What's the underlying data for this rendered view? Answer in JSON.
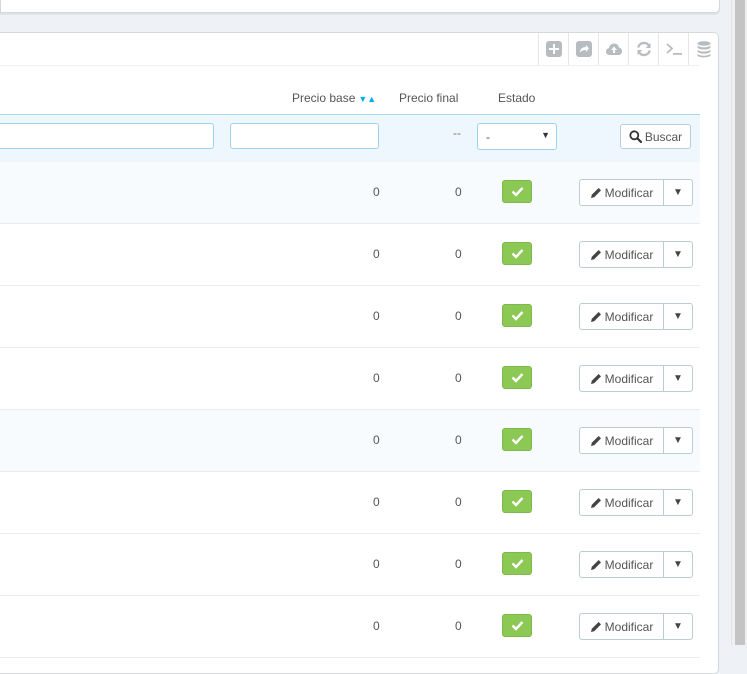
{
  "columns": {
    "precio_base": "Precio base",
    "precio_final": "Precio final",
    "estado": "Estado"
  },
  "filters": {
    "precio_final_placeholder": "--",
    "estado_value": "-",
    "search_label": "Buscar"
  },
  "rows": [
    {
      "precio_base": "0",
      "precio_final": "0",
      "edit_label": "Modificar"
    },
    {
      "precio_base": "0",
      "precio_final": "0",
      "edit_label": "Modificar"
    },
    {
      "precio_base": "0",
      "precio_final": "0",
      "edit_label": "Modificar"
    },
    {
      "precio_base": "0",
      "precio_final": "0",
      "edit_label": "Modificar"
    },
    {
      "precio_base": "0",
      "precio_final": "0",
      "edit_label": "Modificar"
    },
    {
      "precio_base": "0",
      "precio_final": "0",
      "edit_label": "Modificar"
    },
    {
      "precio_base": "0",
      "precio_final": "0",
      "edit_label": "Modificar"
    },
    {
      "precio_base": "0",
      "precio_final": "0",
      "edit_label": "Modificar"
    }
  ],
  "toolbar_icons": [
    "add-icon",
    "export-icon",
    "cloud-upload-icon",
    "refresh-icon",
    "terminal-icon",
    "database-icon"
  ],
  "colors": {
    "accent": "#00aff0",
    "status_active": "#8bc954",
    "filter_bg": "#edf7fd"
  }
}
